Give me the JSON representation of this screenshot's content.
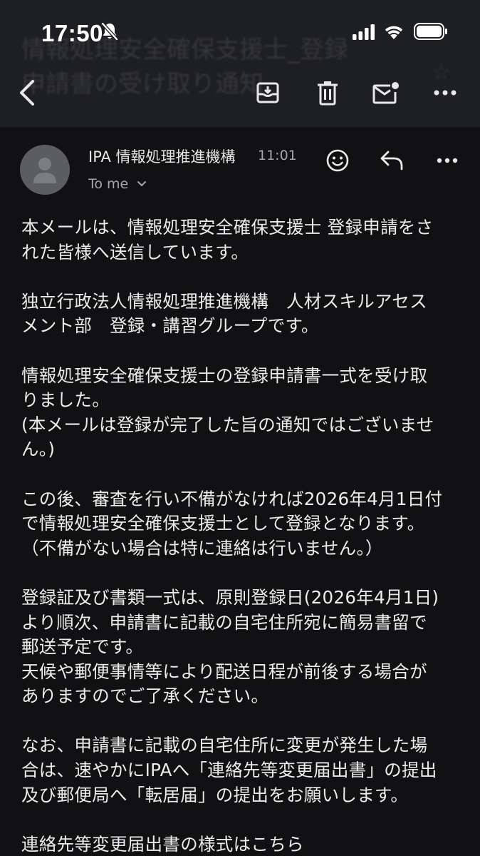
{
  "status_bar": {
    "time": "17:50",
    "icons": [
      "mute-bell-icon",
      "cellular-signal-icon",
      "wifi-icon",
      "battery-icon"
    ]
  },
  "header": {
    "ghost_title_line1": "情報処理安全確保支援士_登録",
    "ghost_title_line2": "申請書の受け取り通知",
    "ghost_star": "☆",
    "toolbar_icons": [
      "back-icon",
      "archive-icon",
      "delete-icon",
      "mark-unread-icon",
      "more-icon"
    ]
  },
  "sender": {
    "name": "IPA 情報処理推進機構",
    "time": "11:01",
    "recipient": "To me",
    "actions": [
      "emoji-reaction-icon",
      "reply-icon",
      "more-icon"
    ]
  },
  "body": {
    "paragraphs": [
      "本メールは、情報処理安全確保支援士 登録申請をさ\nれた皆様へ送信しています。",
      "独立行政法人情報処理推進機構　人材スキルアセス\nメント部　登録・講習グループです。",
      "情報処理安全確保支援士の登録申請書一式を受け取\nりました。\n(本メールは登録が完了した旨の通知ではございませ\nん。)",
      "この後、審査を行い不備がなければ2026年4月1日付\nで情報処理安全確保支援士として登録となります。\n（不備がない場合は特に連絡は行いません。）",
      "登録証及び書類一式は、原則登録日(2026年4月1日)\nより順次、申請書に記載の自宅住所宛に簡易書留で\n郵送予定です。\n天候や郵便事情等により配送日程が前後する場合が\nありますのでご了承ください。",
      "なお、申請書に記載の自宅住所に変更が発生した場\n合は、速やかにIPAへ「連絡先等変更届出書」の提出\n及び郵便局へ「転居届」の提出をお願いします。",
      "連絡先等変更届出書の様式はこちら"
    ]
  },
  "colors": {
    "background": "#111113",
    "header_background": "#1e1f22",
    "text": "#ececec",
    "secondary_text": "#a7a7a9",
    "avatar": "#5b5d60"
  }
}
